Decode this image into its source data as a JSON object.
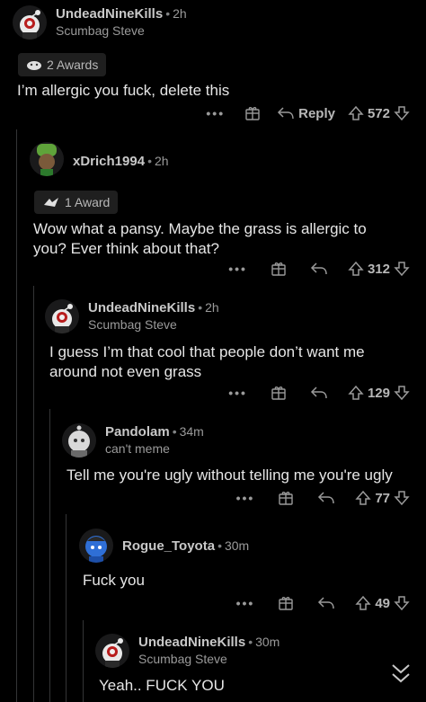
{
  "comments": [
    {
      "username": "UndeadNineKills",
      "time": "2h",
      "flair": "Scumbag Steve",
      "awards": "2 Awards",
      "text": "I’m allergic you fuck, delete this",
      "reply_label": "Reply",
      "score": "572"
    },
    {
      "username": "xDrich1994",
      "time": "2h",
      "awards": "1 Award",
      "text": "Wow what a pansy. Maybe the grass is allergic to you? Ever think about that?",
      "score": "312"
    },
    {
      "username": "UndeadNineKills",
      "time": "2h",
      "flair": "Scumbag Steve",
      "text": "I guess I’m that cool that people don’t want me around not even grass",
      "score": "129"
    },
    {
      "username": "Pandolam",
      "time": "34m",
      "flair": "can't meme",
      "text": "Tell me you're ugly without telling me you're ugly",
      "score": "77"
    },
    {
      "username": "Rogue_Toyota",
      "time": "30m",
      "text": "Fuck you",
      "score": "49"
    },
    {
      "username": "UndeadNineKills",
      "time": "30m",
      "flair": "Scumbag Steve",
      "text": "Yeah.. FUCK YOU"
    }
  ],
  "more_label": "•••",
  "colors": {
    "bg": "#000000",
    "thread": "#343536",
    "text": "#e6e6e6",
    "muted": "#9a9a9a"
  },
  "icons": [
    "more-icon",
    "gift-icon",
    "reply-icon",
    "upvote-icon",
    "downvote-icon",
    "collapse-chevron-icon"
  ]
}
